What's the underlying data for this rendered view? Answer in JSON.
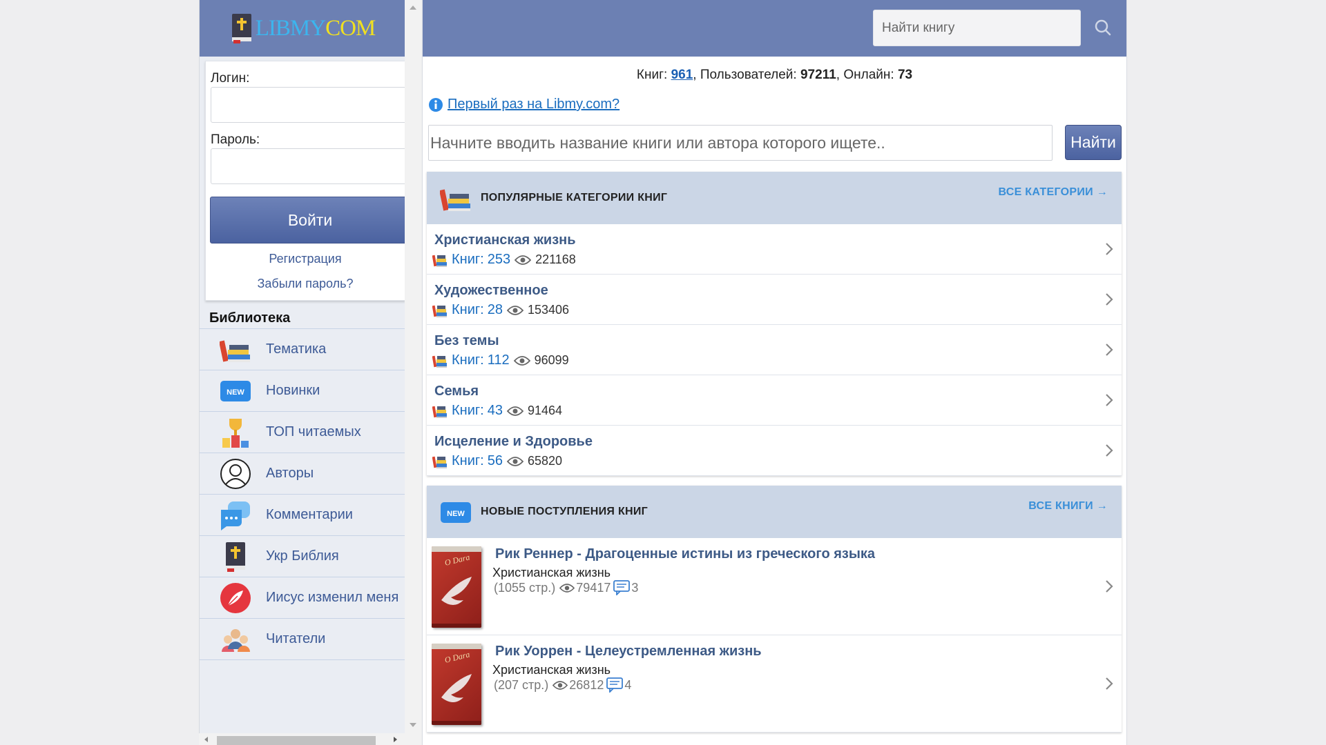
{
  "sidebar": {
    "logo": {
      "text_a": "LIBMY",
      "text_b": "COM"
    },
    "login": {
      "login_label": "Логин:",
      "password_label": "Пароль:",
      "login_value": "",
      "password_value": "",
      "submit_label": "Войти",
      "register_label": "Регистрация",
      "forgot_label": "Забыли пароль?"
    },
    "library_title": "Библиотека",
    "menu": [
      {
        "label": "Тематика",
        "icon": "books-icon"
      },
      {
        "label": "Новинки",
        "icon": "new-badge-icon"
      },
      {
        "label": "ТОП читаемых",
        "icon": "trophy-icon"
      },
      {
        "label": "Авторы",
        "icon": "user-icon"
      },
      {
        "label": "Комментарии",
        "icon": "comments-icon"
      },
      {
        "label": "Укр Библия",
        "icon": "bible-icon"
      },
      {
        "label": "Иисус изменил меня",
        "icon": "feather-icon"
      },
      {
        "label": "Читатели",
        "icon": "readers-icon"
      }
    ]
  },
  "header": {
    "search_placeholder": "Найти книгу"
  },
  "stats": {
    "books_label": "Книг:",
    "books_value": "961",
    "users_label": ", Пользователей:",
    "users_value": "97211",
    "online_label": ", Онлайн:",
    "online_value": "73"
  },
  "first_time_link": "Первый раз на Libmy.com?",
  "main_search": {
    "placeholder": "Начните вводить название книги или автора которого ищете..",
    "button_label": "Найти"
  },
  "popular": {
    "title": "ПОПУЛЯРНЫЕ КАТЕГОРИИ КНИГ",
    "all_link": "ВСЕ КАТЕГОРИИ →",
    "count_prefix": "Книг:",
    "items": [
      {
        "title": "Христианская жизнь",
        "count": "253",
        "views": "221168"
      },
      {
        "title": "Художественное",
        "count": "28",
        "views": "153406"
      },
      {
        "title": "Без темы",
        "count": "112",
        "views": "96099"
      },
      {
        "title": "Семья",
        "count": "43",
        "views": "91464"
      },
      {
        "title": "Исцеление и Здоровье",
        "count": "56",
        "views": "65820"
      }
    ]
  },
  "new_books": {
    "title": "НОВЫЕ ПОСТУПЛЕНИЯ КНИГ",
    "all_link": "ВСЕ КНИГИ →",
    "badge": "NEW",
    "items": [
      {
        "title": "Рик Реннер - Драгоценные истины из греческого языка",
        "category": "Христианская жизнь",
        "pages": "(1055 стр.)",
        "views": "79417",
        "comments": "3"
      },
      {
        "title": "Рик Уоррен - Целеустремленная жизнь",
        "category": "Христианская жизнь",
        "pages": "(207 стр.)",
        "views": "26812",
        "comments": "4"
      }
    ]
  },
  "colors": {
    "header_bg": "#6c80b3",
    "section_head_bg": "#cbd6e6",
    "link": "#1a6dbf",
    "accent_link": "#3a8fd8"
  }
}
